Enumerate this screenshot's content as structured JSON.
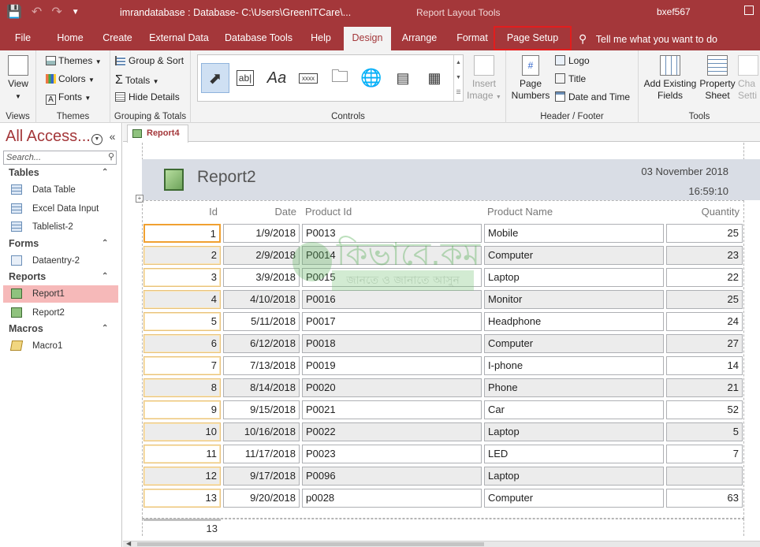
{
  "titlebar": {
    "title": "imrandatabase : Database- C:\\Users\\GreenITCare\\...",
    "context": "Report Layout Tools",
    "user": "bxef567"
  },
  "tabs": [
    "File",
    "Home",
    "Create",
    "External Data",
    "Database Tools",
    "Help",
    "Design",
    "Arrange",
    "Format",
    "Page Setup"
  ],
  "active_tab": "Design",
  "highlighted_tab": "Page Setup",
  "tell_me": "Tell me what you want to do",
  "ribbon": {
    "views": {
      "view_label": "View",
      "group": "Views"
    },
    "themes": {
      "themes": "Themes",
      "colors": "Colors",
      "fonts": "Fonts",
      "group": "Themes"
    },
    "grouping": {
      "group_sort": "Group & Sort",
      "totals": "Totals",
      "hide_details": "Hide Details",
      "group": "Grouping & Totals"
    },
    "controls": {
      "insert_image_1": "Insert",
      "insert_image_2": "Image",
      "group": "Controls",
      "textbox": "ab|",
      "label": "Aa",
      "button": "xxxx"
    },
    "header_footer": {
      "page_numbers_1": "Page",
      "page_numbers_2": "Numbers",
      "logo": "Logo",
      "title": "Title",
      "date_time": "Date and Time",
      "group": "Header / Footer"
    },
    "tools": {
      "add_fields_1": "Add Existing",
      "add_fields_2": "Fields",
      "property_1": "Property",
      "property_2": "Sheet",
      "change_1": "Cha",
      "change_2": "Setti",
      "group": "Tools"
    }
  },
  "nav": {
    "title": "All Access...",
    "search_placeholder": "Search...",
    "sections": [
      {
        "name": "Tables",
        "items": [
          "Data Table",
          "Excel Data Input",
          "Tablelist-2"
        ]
      },
      {
        "name": "Forms",
        "items": [
          "Dataentry-2"
        ]
      },
      {
        "name": "Reports",
        "items": [
          "Report1",
          "Report2"
        ]
      },
      {
        "name": "Macros",
        "items": [
          "Macro1"
        ]
      }
    ],
    "selected_item": "Report1"
  },
  "document": {
    "tab_label": "Report4",
    "report_title": "Report2",
    "date": "03 November 2018",
    "time": "16:59:10",
    "columns": [
      "Id",
      "Date",
      "Product Id",
      "Product Name",
      "Quantity"
    ],
    "rows": [
      [
        "1",
        "1/9/2018",
        "P0013",
        "Mobile",
        "25"
      ],
      [
        "2",
        "2/9/2018",
        "P0014",
        "Computer",
        "23"
      ],
      [
        "3",
        "3/9/2018",
        "P0015",
        "Laptop",
        "22"
      ],
      [
        "4",
        "4/10/2018",
        "P0016",
        "Monitor",
        "25"
      ],
      [
        "5",
        "5/11/2018",
        "P0017",
        "Headphone",
        "24"
      ],
      [
        "6",
        "6/12/2018",
        "P0018",
        "Computer",
        "27"
      ],
      [
        "7",
        "7/13/2018",
        "P0019",
        "I-phone",
        "14"
      ],
      [
        "8",
        "8/14/2018",
        "P0020",
        "Phone",
        "21"
      ],
      [
        "9",
        "9/15/2018",
        "P0021",
        "Car",
        "52"
      ],
      [
        "10",
        "10/16/2018",
        "P0022",
        "Laptop",
        "5"
      ],
      [
        "11",
        "11/17/2018",
        "P0023",
        "LED",
        "7"
      ],
      [
        "12",
        "9/17/2018",
        "P0096",
        "Laptop",
        ""
      ],
      [
        "13",
        "9/20/2018",
        "p0028",
        "Computer",
        "63"
      ]
    ],
    "record_count": "13"
  },
  "watermark": {
    "line1": "কিভাবে.কম",
    "line2": "জানতে ও জানাতে আসুন"
  },
  "colors": {
    "accent": "#a4373a",
    "selected_nav": "#f6b9b9",
    "header_band": "#d9dde5",
    "highlight_box": "#e31d1d"
  }
}
